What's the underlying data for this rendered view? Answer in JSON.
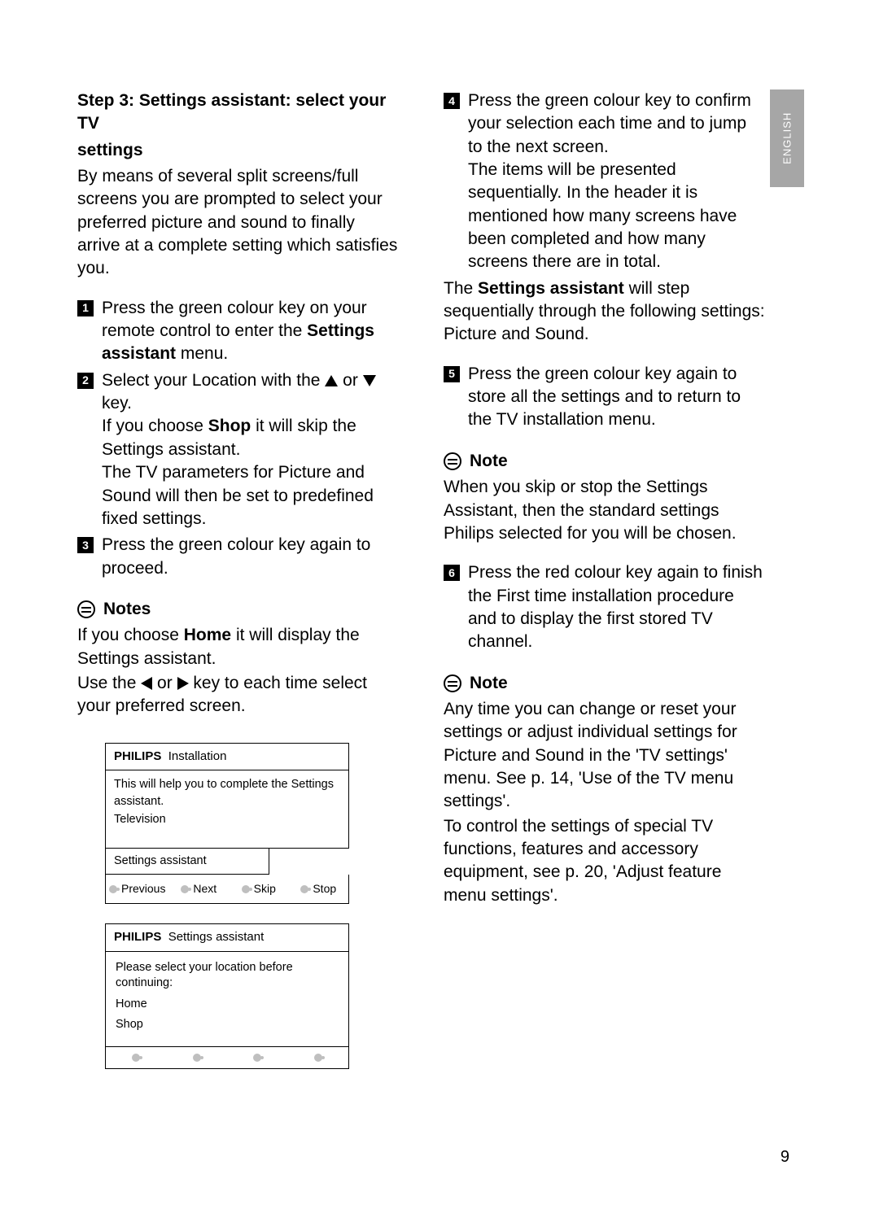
{
  "lang_tab": "ENGLISH",
  "page_number": "9",
  "left": {
    "heading_l1": "Step 3: Settings assistant: select your TV",
    "heading_l2": "settings",
    "intro": "By means of several split screens/full screens you are prompted to select your preferred picture and sound to finally arrive at a complete setting which satisfies you.",
    "step1_a": "Press the green colour key on your remote control to enter the ",
    "step1_b": "Settings assistant",
    "step1_c": " menu.",
    "step2_a": "Select your Location with the ",
    "step2_b": " or ",
    "step2_c": " key.",
    "step2_d1": "If you choose ",
    "step2_d2": "Shop",
    "step2_d3": " it will skip the Settings assistant.",
    "step2_e": "The TV parameters for Picture and Sound will then be set to predefined fixed settings.",
    "step3": "Press the green colour key again to proceed.",
    "notes_title": "Notes",
    "notes_p1a": "If you choose ",
    "notes_p1b": "Home",
    "notes_p1c": " it will display the Settings assistant.",
    "notes_p2a": "Use the ",
    "notes_p2b": " or ",
    "notes_p2c": " key to each time select your preferred screen."
  },
  "right": {
    "step4_a": "Press the green colour key to confirm your selection each time and to jump to the next screen.",
    "step4_b": "The items will be presented sequentially. In the header it is mentioned how many screens have been completed and how many screens there are in total.",
    "mid_a": "The ",
    "mid_b": "Settings assistant",
    "mid_c": " will step sequentially through the following settings: Picture and Sound.",
    "step5": "Press the green colour key again to store all the settings and to return to the TV installation menu.",
    "note1_title": "Note",
    "note1_body": "When you skip or stop the Settings Assistant, then the standard settings Philips selected for you will be chosen.",
    "step6": "Press the red colour key again to finish the First time installation procedure and to display the first stored TV channel.",
    "note2_title": "Note",
    "note2_p1": "Any time you can change or reset your settings or adjust individual settings for Picture and Sound in the 'TV settings' menu. See p. 14, 'Use of the TV menu settings'.",
    "note2_p2": "To control the settings of special TV functions, features and accessory equipment, see p. 20, 'Adjust feature menu settings'."
  },
  "tv1": {
    "brand": "PHILIPS",
    "title": "Installation",
    "body_l1": "This will help you to complete the Settings",
    "body_l2": "assistant.",
    "body_l3": "Television",
    "sa": "Settings assistant",
    "sk_prev": "Previous",
    "sk_next": "Next",
    "sk_skip": "Skip",
    "sk_stop": "Stop"
  },
  "tv2": {
    "brand": "PHILIPS",
    "title": "Settings assistant",
    "body_l1": "Please select your location before continuing:",
    "opt1": "Home",
    "opt2": "Shop"
  }
}
